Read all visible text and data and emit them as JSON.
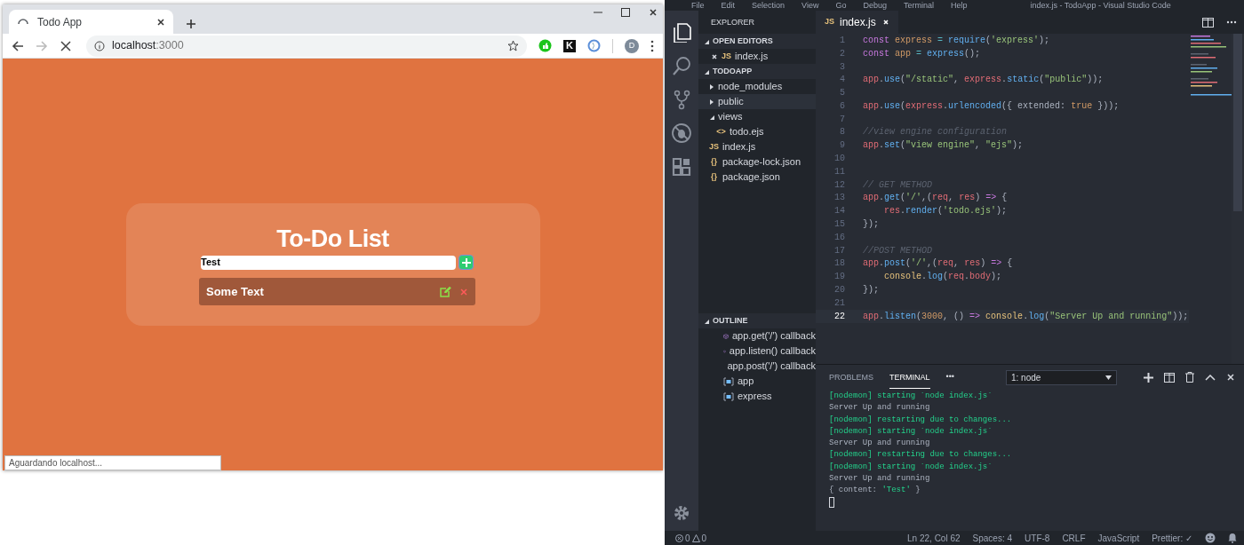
{
  "browser": {
    "tab": {
      "title": "Todo App",
      "loading": true
    },
    "nav": [
      {
        "kind": "back",
        "disabled": false
      },
      {
        "kind": "forward",
        "disabled": true
      },
      {
        "kind": "stop",
        "disabled": false
      }
    ],
    "url": {
      "host": "localhost",
      "port": ":3000"
    },
    "extensions": [
      {
        "kind": "thumb"
      },
      {
        "kind": "letter",
        "label": "K"
      },
      {
        "kind": "ring"
      }
    ],
    "profile": "D",
    "page": {
      "title": "To-Do List",
      "input_value": "Test",
      "items": [
        {
          "text": "Some Text"
        }
      ]
    },
    "status": "Aguardando localhost..."
  },
  "vscode": {
    "menu": [
      "File",
      "Edit",
      "Selection",
      "View",
      "Go",
      "Debug",
      "Terminal",
      "Help"
    ],
    "title": "index.js - TodoApp - Visual Studio Code",
    "activity": [
      {
        "kind": "files",
        "selected": true
      },
      {
        "kind": "search",
        "selected": false
      },
      {
        "kind": "scm",
        "selected": false
      },
      {
        "kind": "debug",
        "selected": false
      },
      {
        "kind": "extensions",
        "selected": false
      }
    ],
    "sidebar": {
      "title": "EXPLORER",
      "sections": [
        {
          "kind": "open_editors",
          "title": "OPEN EDITORS",
          "expanded": true,
          "items": [
            {
              "name": "index.js",
              "kind": "js",
              "icon": "JS",
              "selected": false
            }
          ]
        },
        {
          "kind": "folder",
          "title": "TODOAPP",
          "expanded": true,
          "items": [
            {
              "name": "node_modules",
              "kind": "folder",
              "expanded": false,
              "selected": false
            },
            {
              "name": "public",
              "kind": "folder",
              "expanded": false,
              "selected": true
            },
            {
              "name": "views",
              "kind": "folder",
              "expanded": true,
              "selected": false,
              "children": [
                {
                  "name": "todo.ejs",
                  "kind": "ejs",
                  "icon": "<>",
                  "selected": false
                }
              ]
            },
            {
              "name": "index.js",
              "kind": "js",
              "icon": "JS",
              "selected": false
            },
            {
              "name": "package-lock.json",
              "kind": "json",
              "icon": "{}",
              "selected": false
            },
            {
              "name": "package.json",
              "kind": "json",
              "icon": "{}",
              "selected": false
            }
          ]
        },
        {
          "kind": "outline",
          "title": "OUTLINE",
          "expanded": true,
          "items": [
            {
              "name": "app.get('/') callback",
              "kind": "method",
              "selected": false
            },
            {
              "name": "app.listen() callback",
              "kind": "method",
              "selected": false
            },
            {
              "name": "app.post('/') callback",
              "kind": "method",
              "selected": false
            },
            {
              "name": "app",
              "kind": "variable",
              "selected": false
            },
            {
              "name": "express",
              "kind": "variable",
              "selected": false
            }
          ]
        }
      ]
    },
    "editor": {
      "tabs": [
        {
          "title": "index.js",
          "kind": "js",
          "icon": "JS",
          "selected": true
        }
      ],
      "lines": [
        {
          "number": "1",
          "current": false,
          "tokens": [
            {
              "kind": "keyword",
              "text": "const "
            },
            {
              "kind": "decl",
              "text": "express "
            },
            {
              "kind": "op",
              "text": "= "
            },
            {
              "kind": "fn",
              "text": "require"
            },
            {
              "kind": "plain",
              "text": "("
            },
            {
              "kind": "str",
              "text": "'express'"
            },
            {
              "kind": "plain",
              "text": ");"
            }
          ]
        },
        {
          "number": "2",
          "current": false,
          "tokens": [
            {
              "kind": "keyword",
              "text": "const "
            },
            {
              "kind": "decl",
              "text": "app "
            },
            {
              "kind": "op",
              "text": "= "
            },
            {
              "kind": "fn",
              "text": "express"
            },
            {
              "kind": "plain",
              "text": "();"
            }
          ]
        },
        {
          "number": "3",
          "current": false
        },
        {
          "number": "4",
          "current": false,
          "tokens": [
            {
              "kind": "obj",
              "text": "app"
            },
            {
              "kind": "plain",
              "text": "."
            },
            {
              "kind": "fn",
              "text": "use"
            },
            {
              "kind": "plain",
              "text": "("
            },
            {
              "kind": "str",
              "text": "\"/static\""
            },
            {
              "kind": "plain",
              "text": ", "
            },
            {
              "kind": "obj",
              "text": "express"
            },
            {
              "kind": "plain",
              "text": "."
            },
            {
              "kind": "fn",
              "text": "static"
            },
            {
              "kind": "plain",
              "text": "("
            },
            {
              "kind": "str",
              "text": "\"public\""
            },
            {
              "kind": "plain",
              "text": "));"
            }
          ]
        },
        {
          "number": "5",
          "current": false
        },
        {
          "number": "6",
          "current": false,
          "tokens": [
            {
              "kind": "obj",
              "text": "app"
            },
            {
              "kind": "plain",
              "text": "."
            },
            {
              "kind": "fn",
              "text": "use"
            },
            {
              "kind": "plain",
              "text": "("
            },
            {
              "kind": "obj",
              "text": "express"
            },
            {
              "kind": "plain",
              "text": "."
            },
            {
              "kind": "fn",
              "text": "urlencoded"
            },
            {
              "kind": "plain",
              "text": "({ extended: "
            },
            {
              "kind": "num",
              "text": "true"
            },
            {
              "kind": "plain",
              "text": " }));"
            }
          ]
        },
        {
          "number": "7",
          "current": false
        },
        {
          "number": "8",
          "current": false,
          "tokens": [
            {
              "kind": "comment",
              "text": "//view engine configuration"
            }
          ]
        },
        {
          "number": "9",
          "current": false,
          "tokens": [
            {
              "kind": "obj",
              "text": "app"
            },
            {
              "kind": "plain",
              "text": "."
            },
            {
              "kind": "fn",
              "text": "set"
            },
            {
              "kind": "plain",
              "text": "("
            },
            {
              "kind": "str",
              "text": "\"view engine\""
            },
            {
              "kind": "plain",
              "text": ", "
            },
            {
              "kind": "str",
              "text": "\"ejs\""
            },
            {
              "kind": "plain",
              "text": ");"
            }
          ]
        },
        {
          "number": "10",
          "current": false
        },
        {
          "number": "11",
          "current": false
        },
        {
          "number": "12",
          "current": false,
          "tokens": [
            {
              "kind": "comment",
              "text": "// GET METHOD"
            }
          ]
        },
        {
          "number": "13",
          "current": false,
          "tokens": [
            {
              "kind": "obj",
              "text": "app"
            },
            {
              "kind": "plain",
              "text": "."
            },
            {
              "kind": "fn",
              "text": "get"
            },
            {
              "kind": "plain",
              "text": "("
            },
            {
              "kind": "str",
              "text": "'/'"
            },
            {
              "kind": "plain",
              "text": ",("
            },
            {
              "kind": "obj",
              "text": "req"
            },
            {
              "kind": "plain",
              "text": ", "
            },
            {
              "kind": "obj",
              "text": "res"
            },
            {
              "kind": "plain",
              "text": ") "
            },
            {
              "kind": "keyword",
              "text": "=>"
            },
            {
              "kind": "plain",
              "text": " {"
            }
          ]
        },
        {
          "number": "14",
          "current": false,
          "indented": true,
          "tokens": [
            {
              "kind": "obj",
              "text": "res"
            },
            {
              "kind": "plain",
              "text": "."
            },
            {
              "kind": "fn",
              "text": "render"
            },
            {
              "kind": "plain",
              "text": "("
            },
            {
              "kind": "str",
              "text": "'todo.ejs'"
            },
            {
              "kind": "plain",
              "text": ");"
            }
          ]
        },
        {
          "number": "15",
          "current": false,
          "tokens": [
            {
              "kind": "plain",
              "text": "});"
            }
          ]
        },
        {
          "number": "16",
          "current": false
        },
        {
          "number": "17",
          "current": false,
          "tokens": [
            {
              "kind": "comment",
              "text": "//POST METHOD"
            }
          ]
        },
        {
          "number": "18",
          "current": false,
          "tokens": [
            {
              "kind": "obj",
              "text": "app"
            },
            {
              "kind": "plain",
              "text": "."
            },
            {
              "kind": "fn",
              "text": "post"
            },
            {
              "kind": "plain",
              "text": "("
            },
            {
              "kind": "str",
              "text": "'/'"
            },
            {
              "kind": "plain",
              "text": ",("
            },
            {
              "kind": "obj",
              "text": "req"
            },
            {
              "kind": "plain",
              "text": ", "
            },
            {
              "kind": "obj",
              "text": "res"
            },
            {
              "kind": "plain",
              "text": ") "
            },
            {
              "kind": "keyword",
              "text": "=>"
            },
            {
              "kind": "plain",
              "text": " {"
            }
          ]
        },
        {
          "number": "19",
          "current": false,
          "indented": true,
          "tokens": [
            {
              "kind": "cls",
              "text": "console"
            },
            {
              "kind": "plain",
              "text": "."
            },
            {
              "kind": "fn",
              "text": "log"
            },
            {
              "kind": "plain",
              "text": "("
            },
            {
              "kind": "obj",
              "text": "req"
            },
            {
              "kind": "plain",
              "text": "."
            },
            {
              "kind": "obj",
              "text": "body"
            },
            {
              "kind": "plain",
              "text": ");"
            }
          ]
        },
        {
          "number": "20",
          "current": false,
          "tokens": [
            {
              "kind": "plain",
              "text": "});"
            }
          ]
        },
        {
          "number": "21",
          "current": false
        },
        {
          "number": "22",
          "current": true,
          "tokens": [
            {
              "kind": "obj",
              "text": "app"
            },
            {
              "kind": "plain",
              "text": "."
            },
            {
              "kind": "fn",
              "text": "listen"
            },
            {
              "kind": "plain",
              "text": "("
            },
            {
              "kind": "num",
              "text": "3000"
            },
            {
              "kind": "plain",
              "text": ", () "
            },
            {
              "kind": "keyword",
              "text": "=> "
            },
            {
              "kind": "cls",
              "text": "console"
            },
            {
              "kind": "plain",
              "text": "."
            },
            {
              "kind": "fn",
              "text": "log"
            },
            {
              "kind": "plain",
              "text": "("
            },
            {
              "kind": "str",
              "text": "\"Server Up and running\""
            },
            {
              "kind": "plain",
              "text": "));"
            }
          ]
        }
      ]
    },
    "panel": {
      "tabs": [
        {
          "label": "PROBLEMS",
          "selected": false
        },
        {
          "label": "TERMINAL",
          "selected": true
        }
      ],
      "more": "•••",
      "dropdown": "1: node",
      "lines": [
        {
          "tokens": [
            {
              "kind": "info",
              "text": "[nodemon] starting `node index.js`"
            }
          ]
        },
        {
          "tokens": [
            {
              "kind": "plain",
              "text": "Server Up and running"
            }
          ]
        },
        {
          "tokens": [
            {
              "kind": "info",
              "text": "[nodemon] restarting due to changes..."
            }
          ]
        },
        {
          "tokens": [
            {
              "kind": "info",
              "text": "[nodemon] starting `node index.js`"
            }
          ]
        },
        {
          "tokens": [
            {
              "kind": "plain",
              "text": "Server Up and running"
            }
          ]
        },
        {
          "tokens": [
            {
              "kind": "info",
              "text": "[nodemon] restarting due to changes..."
            }
          ]
        },
        {
          "tokens": [
            {
              "kind": "info",
              "text": "[nodemon] starting `node index.js`"
            }
          ]
        },
        {
          "tokens": [
            {
              "kind": "plain",
              "text": "Server Up and running"
            }
          ]
        },
        {
          "tokens": [
            {
              "kind": "plain",
              "text": "{ content: "
            },
            {
              "kind": "info",
              "text": "'Test'"
            },
            {
              "kind": "plain",
              "text": " }"
            }
          ]
        }
      ]
    },
    "status_bar": {
      "errors": "0",
      "warnings": "0",
      "items": [
        "Ln 22, Col 62",
        "Spaces: 4",
        "UTF-8",
        "CRLF",
        "JavaScript",
        "Prettier: ✓"
      ]
    }
  }
}
